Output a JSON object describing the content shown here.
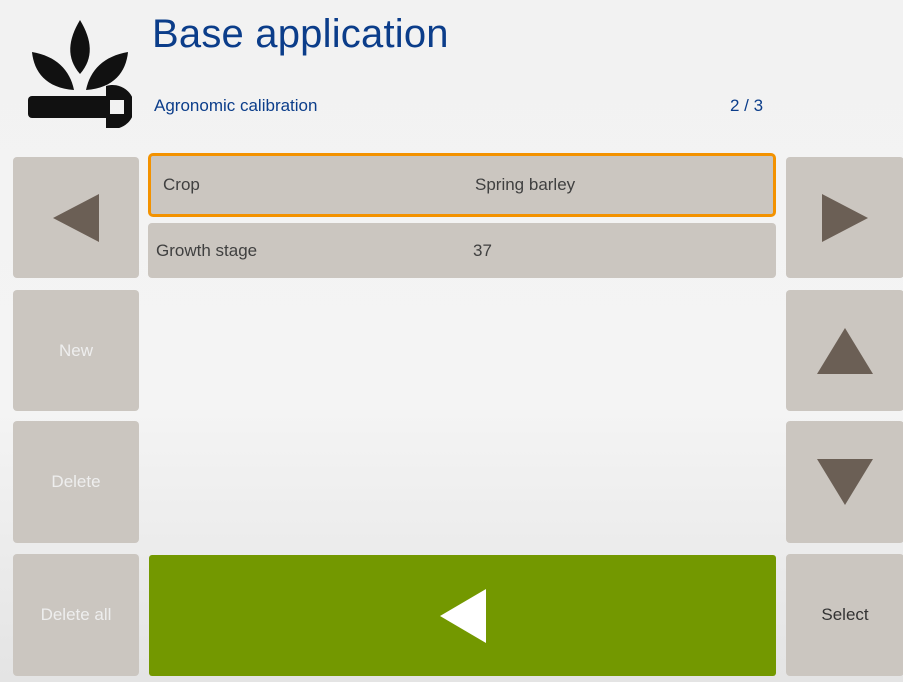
{
  "header": {
    "logo_icon": "plant-wrench-icon",
    "title": "Base application",
    "subtitle": "Agronomic calibration",
    "page_indicator": "2 / 3"
  },
  "left_panel": {
    "prev_icon": "triangle-left-icon",
    "new_label": "New",
    "delete_label": "Delete",
    "delete_all_label": "Delete all"
  },
  "right_panel": {
    "next_icon": "triangle-right-icon",
    "up_icon": "triangle-up-icon",
    "down_icon": "triangle-down-icon",
    "select_label": "Select"
  },
  "list": {
    "rows": [
      {
        "label": "Crop",
        "value": "Spring barley",
        "selected": true
      },
      {
        "label": "Growth stage",
        "value": "37",
        "selected": false
      }
    ]
  },
  "back_button": {
    "icon": "back-arrow-icon"
  },
  "colors": {
    "title": "#0b3d8a",
    "button_bg": "#cbc6c0",
    "selection_border": "#f39200",
    "back_button_bg": "#739800",
    "arrow": "#6b5f55"
  }
}
